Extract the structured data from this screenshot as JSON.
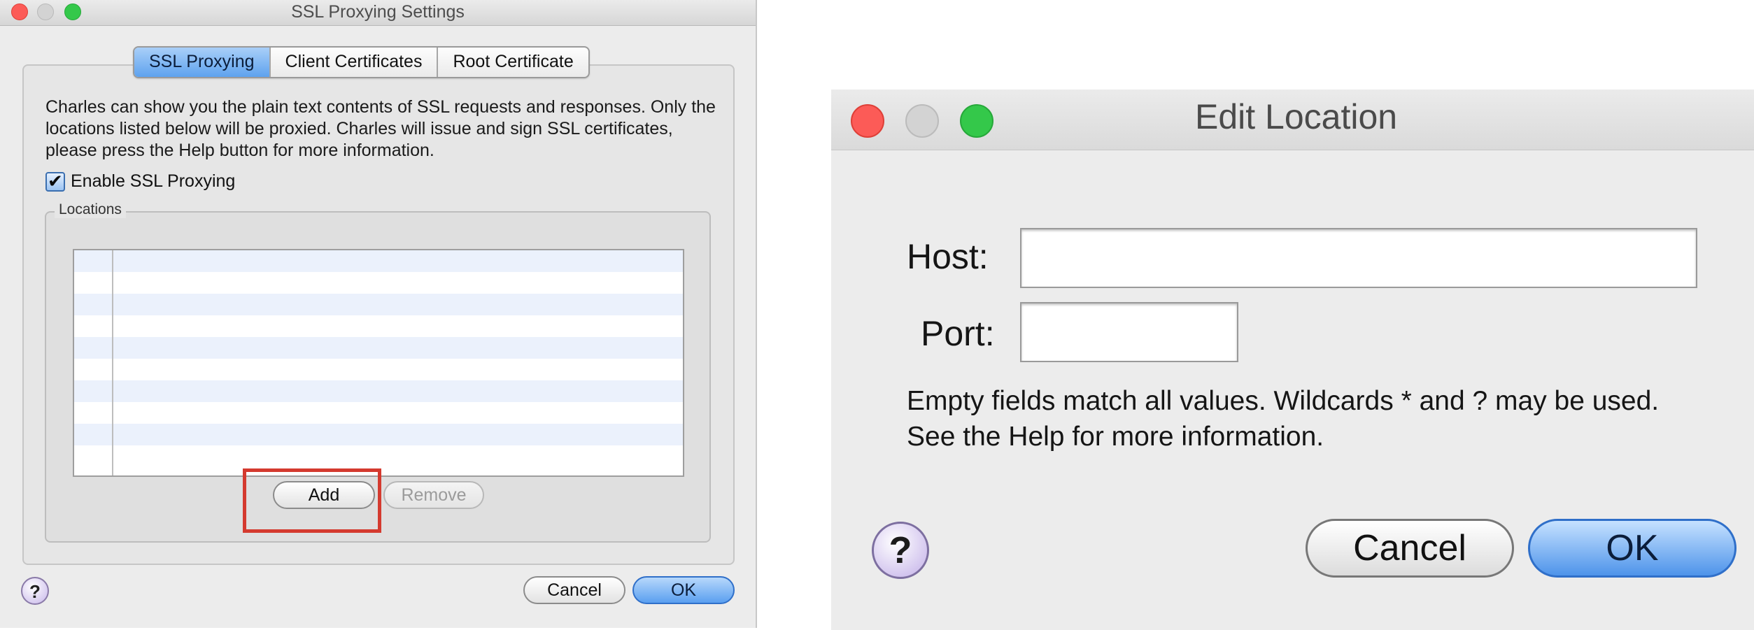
{
  "left_window": {
    "title": "SSL Proxying Settings",
    "tabs": [
      {
        "label": "SSL Proxying",
        "active": true
      },
      {
        "label": "Client Certificates",
        "active": false
      },
      {
        "label": "Root Certificate",
        "active": false
      }
    ],
    "description": "Charles can show you the plain text contents of SSL requests and responses. Only the locations listed below will be proxied. Charles will issue and sign SSL certificates, please press the Help button for more information.",
    "enable_checkbox": {
      "label": "Enable SSL Proxying",
      "checked": true
    },
    "locations": {
      "legend": "Locations",
      "rows": []
    },
    "buttons": {
      "add": "Add",
      "remove": "Remove",
      "cancel": "Cancel",
      "ok": "OK",
      "help": "?"
    },
    "highlight_color": "#d43a2f"
  },
  "right_window": {
    "title": "Edit Location",
    "host_label": "Host:",
    "port_label": "Port:",
    "host_value": "",
    "port_value": "",
    "note": "Empty fields match all values. Wildcards * and ? may be used. See the Help for more information.",
    "buttons": {
      "help": "?",
      "cancel": "Cancel",
      "ok": "OK"
    }
  },
  "colors": {
    "accent_blue": "#5ea2ee",
    "window_bg": "#ececec"
  }
}
